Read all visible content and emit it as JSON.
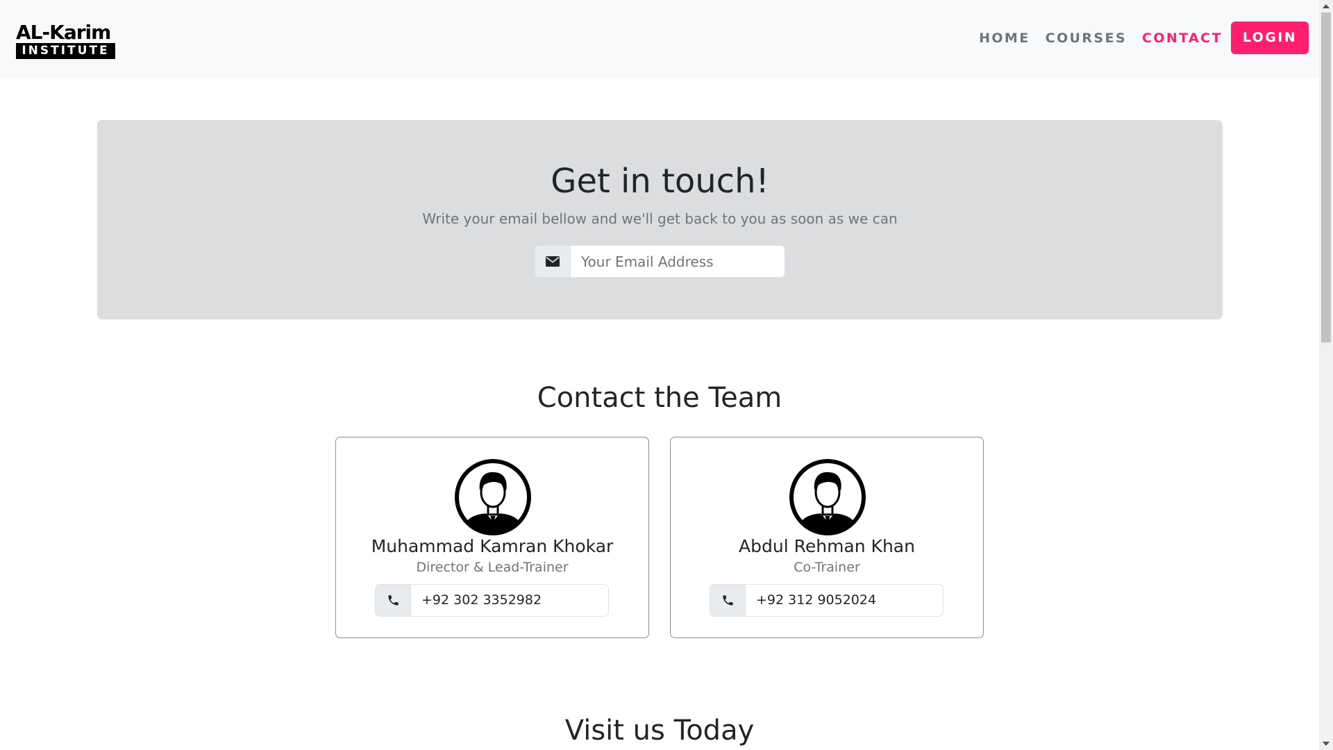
{
  "brand": {
    "line1": "AL-Karim",
    "line2": "INSTITUTE"
  },
  "nav": {
    "items": [
      {
        "label": "HOME",
        "active": false
      },
      {
        "label": "COURSES",
        "active": false
      },
      {
        "label": "CONTACT",
        "active": true
      }
    ],
    "login_label": "LOGIN"
  },
  "hero": {
    "title": "Get in touch!",
    "subtitle": "Write your email bellow and we'll get back to you as soon as we can",
    "email_placeholder": "Your Email Address",
    "email_value": "",
    "email_icon": "envelope-icon"
  },
  "team": {
    "title": "Contact the Team",
    "members": [
      {
        "name": "Muhammad Kamran Khokar",
        "role": "Director & Lead-Trainer",
        "phone": "+92 302 3352982",
        "avatar_icon": "person-avatar-icon",
        "phone_icon": "phone-icon"
      },
      {
        "name": "Abdul Rehman Khan",
        "role": "Co-Trainer",
        "phone": "+92 312 9052024",
        "avatar_icon": "person-avatar-icon",
        "phone_icon": "phone-icon"
      }
    ]
  },
  "visit": {
    "title": "Visit us Today"
  },
  "colors": {
    "accent": "#ff1f6d",
    "nav_text": "#6c757d",
    "hero_bg": "#dcdddf",
    "navbar_bg": "#f8f9fa"
  }
}
